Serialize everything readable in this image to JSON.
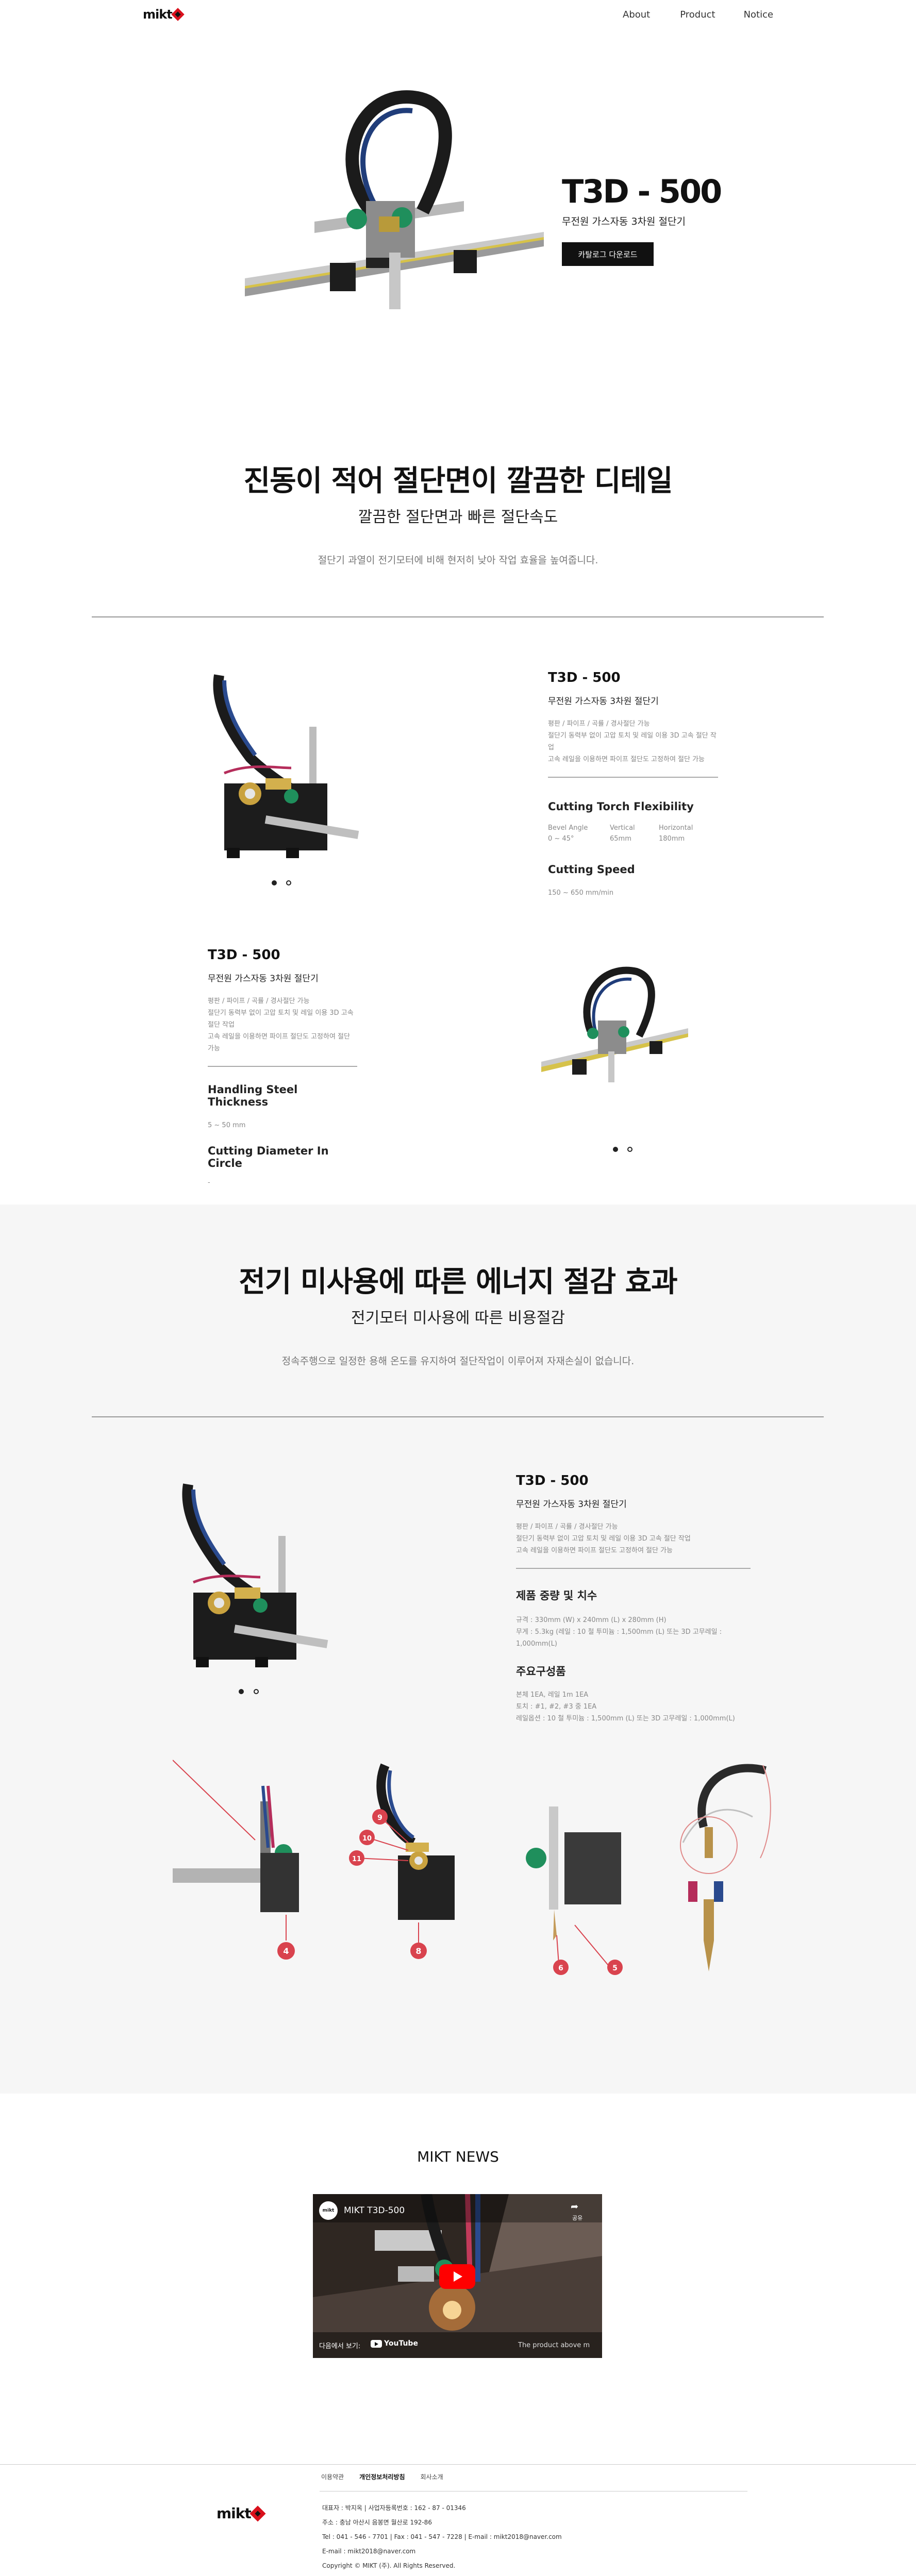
{
  "header": {
    "logo_text": "mikt",
    "nav": [
      "About",
      "Product",
      "Notice"
    ]
  },
  "hero": {
    "title": "T3D - 500",
    "subtitle": "무전원 가스자동 3차원 절단기",
    "button": "카탈로그 다운로드"
  },
  "section1": {
    "title": "진동이 적어 절단면이 깔끔한 디테일",
    "subtitle": "깔끔한 절단면과 빠른 절단속도",
    "desc": "절단기 과열이 전기모터에 비해 현저히 낮아 작업 효율을 높여줍니다."
  },
  "product_a": {
    "title": "T3D - 500",
    "subtitle": "무전원 가스자동 3차원 절단기",
    "lines": [
      "평판 / 파이프 / 곡률 / 경사절단 가능",
      "절단기 동력부 없이 고압 토치 및 레일 이용 3D 고속 절단 작업",
      "고속 레일을 이용하면 파이프 절단도 고정하여 절단 가능"
    ],
    "h1": "Cutting Torch Flexibility",
    "flex_labels": [
      "Bevel Angle",
      "Vertical",
      "Horizontal"
    ],
    "flex_values": [
      "0 ~ 45°",
      "65mm",
      "180mm"
    ],
    "h2": "Cutting Speed",
    "speed": "150 ~ 650 mm/min"
  },
  "product_b": {
    "title": "T3D - 500",
    "subtitle": "무전원 가스자동 3차원 절단기",
    "lines": [
      "평판 / 파이프 / 곡률 / 경사절단 가능",
      "절단기 동력부 없이 고압 토치 및 레일 이용 3D 고속 절단 작업",
      "고속 레일을 이용하면 파이프 절단도 고정하여 절단 가능"
    ],
    "h1": "Handling Steel Thickness",
    "thickness": "5 ~ 50 mm",
    "h2": "Cutting Diameter In Circle",
    "diameter": "-"
  },
  "section2": {
    "title": "전기 미사용에 따른 에너지 절감 효과",
    "subtitle": "전기모터 미사용에 따른 비용절감",
    "desc": "정속주행으로 일정한 용해 온도를 유지하여 절단작업이 이루어져 자재손실이 없습니다."
  },
  "product_c": {
    "title": "T3D - 500",
    "subtitle": "무전원 가스자동 3차원 절단기",
    "lines": [
      "평판 / 파이프 / 곡률 / 경사절단 가능",
      "절단기 동력부 없이 고압 토치 및 레일 이용 3D 고속 절단 작업",
      "고속 레일을 이용하면 파이프 절단도 고정하여 절단 가능"
    ],
    "h1": "제품 중량 및 치수",
    "weight_lines": [
      "규격 : 330mm (W) x 240mm (L) x 280mm (H)",
      "무게 : 5.3kg (레일 : 10 철 투미늄 : 1,500mm (L) 또는 3D 고무레일 : 1,000mm(L)"
    ],
    "h2": "주요구성품",
    "parts_lines": [
      "본체 1EA, 레일 1m 1EA",
      "토치 : #1, #2, #3 중 1EA",
      "레일옵션 : 10 철 투미늄 : 1,500mm (L) 또는 3D 고무레일 : 1,000mm(L)"
    ]
  },
  "callouts": [
    "4",
    "9",
    "10",
    "11",
    "8",
    "6",
    "5"
  ],
  "news": {
    "title": "MIKT NEWS",
    "video_title": "MIKT T3D-500",
    "share": "공유",
    "watch_on": "다음에서 보기:",
    "youtube": "YouTube",
    "caption": "The product above m"
  },
  "footer": {
    "links": [
      "이용약관",
      "개인정보처리방침",
      "회사소개"
    ],
    "info": [
      "대표자 : 박지옥  |  사업자등록번호 : 162 - 87 - 01346",
      "주소 : 충남 아산시 음봉면 월산로 192-86",
      "Tel : 041 - 546 - 7701  |  Fax : 041 - 547 - 7228  |  E-mail : mikt2018@naver.com",
      "E-mail : mikt2018@naver.com",
      "Copyright © MIKT (주). All Rights Reserved."
    ]
  },
  "colors": {
    "brand_red": "#d9101c",
    "dark": "#111111",
    "band": "#f6f6f6",
    "callout": "#d9434e"
  }
}
